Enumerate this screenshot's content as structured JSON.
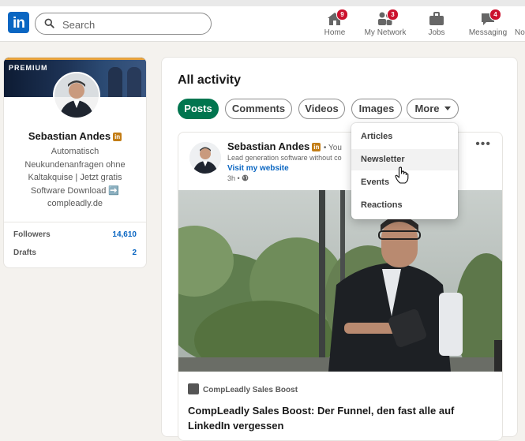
{
  "nav": {
    "search_placeholder": "Search",
    "items": [
      {
        "label": "Home",
        "icon": "home-icon",
        "badge": ""
      },
      {
        "label": "My Network",
        "icon": "people-icon",
        "badge": "3"
      },
      {
        "label": "Jobs",
        "icon": "briefcase-icon",
        "badge": ""
      },
      {
        "label": "Messaging",
        "icon": "chat-icon",
        "badge": "4"
      },
      {
        "label": "No",
        "icon": "bell-icon",
        "badge": ""
      }
    ],
    "home_badge": "9"
  },
  "profile": {
    "banner_label": "PREMIUM",
    "name": "Sebastian Andes",
    "headline": "Automatisch Neukundenanfragen ohne Kaltakquise | Jetzt gratis Software Download ➡️ compleadly.de",
    "stats": [
      {
        "label": "Followers",
        "value": "14,610"
      },
      {
        "label": "Drafts",
        "value": "2"
      }
    ]
  },
  "activity": {
    "title": "All activity",
    "tabs": [
      "Posts",
      "Comments",
      "Videos",
      "Images",
      "More"
    ],
    "active_tab": "Posts",
    "more_menu": [
      "Articles",
      "Newsletter",
      "Events",
      "Reactions"
    ],
    "hovered_item": "Newsletter"
  },
  "post": {
    "author": "Sebastian Andes",
    "degree": "• You",
    "subtitle": "Lead generation software without co",
    "visit_link": "Visit my website",
    "time": "3h •",
    "source": "CompLeadly Sales Boost",
    "headline": "CompLeadly Sales Boost: Der Funnel, den fast alle auf LinkedIn vergessen"
  },
  "colors": {
    "brand_blue": "#0a66c2",
    "active_pill_green": "#01754f",
    "badge_red": "#cb112d"
  }
}
